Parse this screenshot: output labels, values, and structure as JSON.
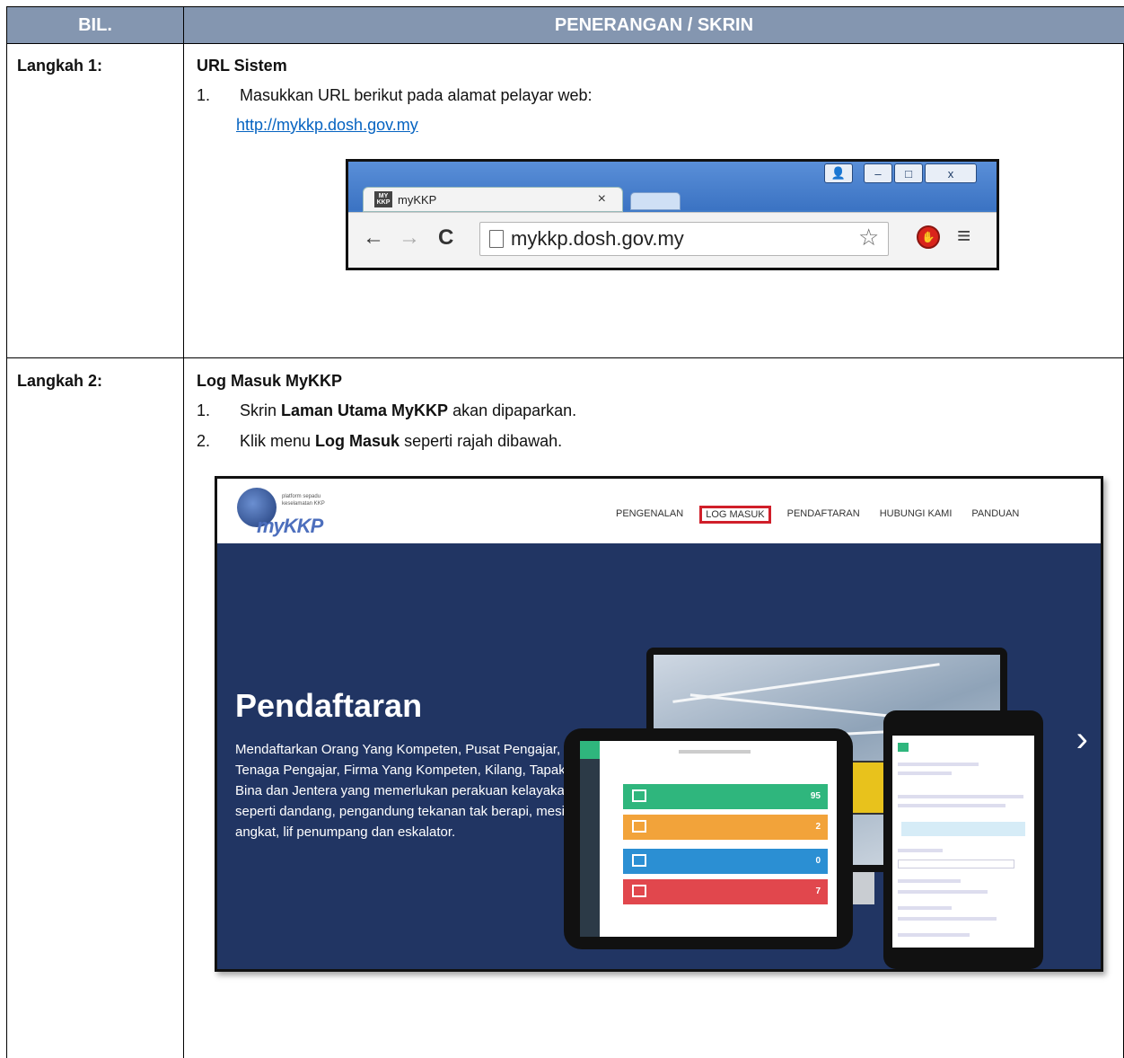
{
  "header": {
    "col1": "BIL.",
    "col2": "PENERANGAN / SKRIN"
  },
  "step1": {
    "label": "Langkah 1:",
    "title": "URL Sistem",
    "item1_num": "1.",
    "item1_text": "Masukkan URL berikut pada alamat pelayar web:",
    "link": "http://mykkp.dosh.gov.my",
    "browser": {
      "tab_title": "myKKP",
      "tab_close": "×",
      "favicon_text": "MY KKP",
      "address": "mykkp.dosh.gov.my",
      "back_icon": "←",
      "forward_icon": "→",
      "reload_icon": "C",
      "star_icon": "☆",
      "menu_icon": "≡",
      "win_user_icon": "👤",
      "win_min_icon": "–",
      "win_max_icon": "□",
      "win_close_icon": "x"
    }
  },
  "step2": {
    "label": "Langkah 2:",
    "title": "Log Masuk MyKKP",
    "item1_num": "1.",
    "item1_pre": "Skrin ",
    "item1_bold": "Laman Utama MyKKP",
    "item1_post": " akan dipaparkan.",
    "item2_num": "2.",
    "item2_pre": "Klik menu ",
    "item2_bold": "Log Masuk",
    "item2_post": " seperti rajah dibawah.",
    "site": {
      "logo_tag": "platform sepadu keselamatan KKP",
      "logo_word": "myKKP",
      "menu": [
        "PENGENALAN",
        "LOG MASUK",
        "PENDAFTARAN",
        "HUBUNGI KAMI",
        "PANDUAN"
      ],
      "menu_highlight_index": 1,
      "hero_title": "Pendaftaran",
      "hero_text": "Mendaftarkan Orang Yang Kompeten, Pusat Pengajar, Tenaga Pengajar, Firma Yang Kompeten, Kilang, Tapak Bina dan Jentera yang memerlukan perakuan kelayakan seperti dandang, pengandung tekanan tak berapi, mesin angkat, lif penumpang dan eskalator.",
      "next_icon": "›",
      "card_values": [
        "95",
        "2",
        "0",
        "7"
      ],
      "card_colors": [
        "#2fb67d",
        "#f2a33a",
        "#2b8fd3",
        "#e1474d"
      ]
    }
  }
}
